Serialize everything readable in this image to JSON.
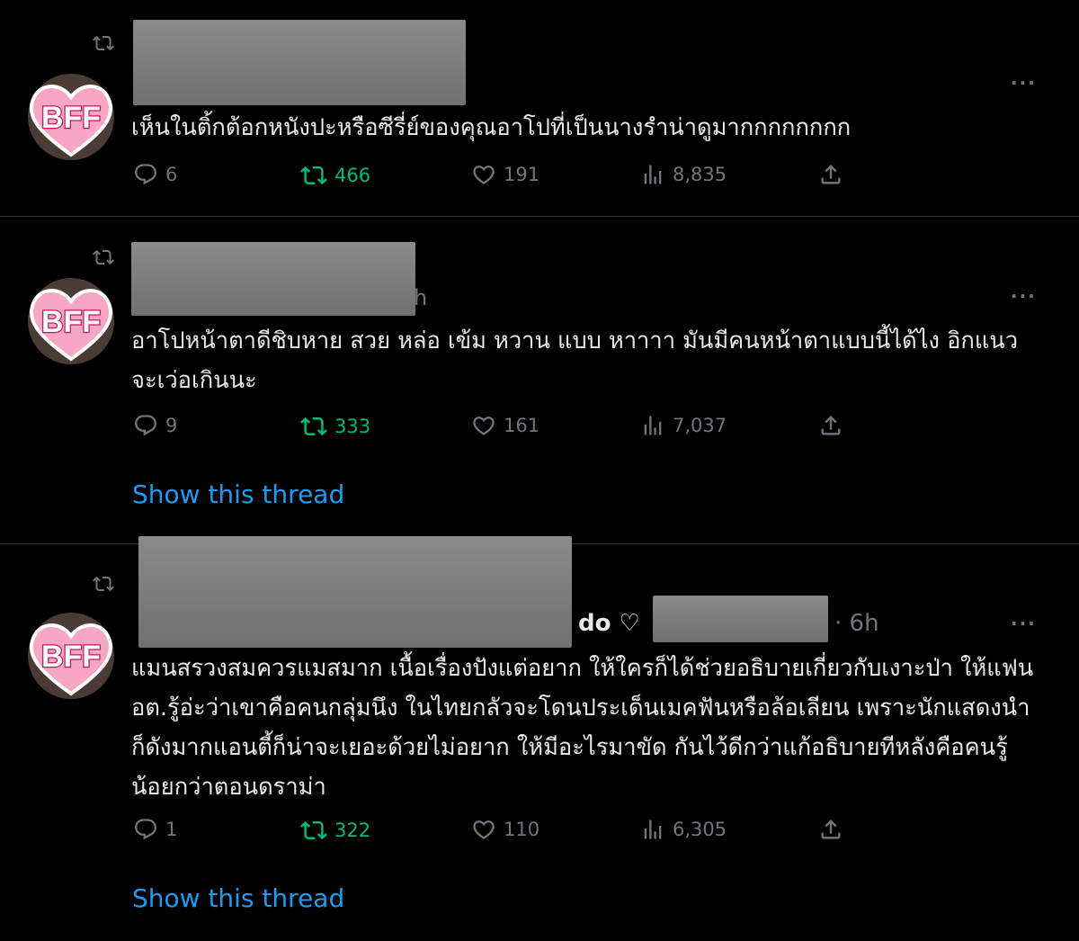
{
  "tweets": [
    {
      "text": "เห็นในติ้กต้อกหนังปะหรือซีรี่ย์ของคุณอาโปที่เป็นนางรำน่าดูมากกกกกกกก",
      "avatar_label": "BFF",
      "more": "···",
      "replies": "6",
      "retweets": "466",
      "likes": "191",
      "views": "8,835"
    },
    {
      "text": "อาโปหน้าตาดีชิบหาย สวย หล่อ เข้ม หวาน แบบ หาาาา มันมีคนหน้าตาแบบนี้ได้ไง อิกแนวจะเว่อเกินนะ",
      "avatar_label": "BFF",
      "more": "···",
      "replies": "9",
      "retweets": "333",
      "likes": "161",
      "views": "7,037",
      "show_thread": "Show this thread",
      "name_residue": "h"
    },
    {
      "text": "แมนสรวงสมควรแมสมาก เนื้อเรื่องปังแต่อยาก ให้ใครก็ได้ช่วยอธิบายเกี่ยวกับเงาะป่า ให้แฟนอต.รู้อ่ะว่าเขาคือคนกลุ่มนึง ในไทยกลัวจะโดนประเด็นเมคฟันหรือล้อเลียน เพราะนักแสดงนำก็ดังมากแอนตี้ก็น่าจะเยอะด้วยไม่อยาก ให้มีอะไรมาขัด กันไว้ดีกว่าแก้อธิบายทีหลังคือคนรู้น้อยกว่าตอนดราม่า",
      "avatar_label": "BFF",
      "more": "···",
      "name_tail": "do ♡",
      "time": "· 6h",
      "replies": "1",
      "retweets": "322",
      "likes": "110",
      "views": "6,305",
      "show_thread": "Show this thread"
    }
  ],
  "colors": {
    "background": "#000000",
    "text": "#e7e9ea",
    "muted": "#71767b",
    "retweet_active": "#00ba7c",
    "link": "#1d9bf0",
    "avatar_heart": "#f7a6c4"
  },
  "icons": [
    "retweet-icon",
    "reply-icon",
    "like-icon",
    "views-icon",
    "share-icon",
    "more-icon"
  ]
}
